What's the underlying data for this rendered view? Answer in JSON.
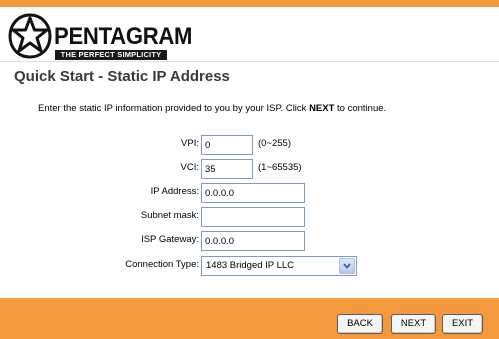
{
  "brand": {
    "name": "PENTAGRAM",
    "tagline": "THE PERFECT SIMPLICITY",
    "accent_color": "#f59a3c"
  },
  "page": {
    "title": "Quick Start - Static IP Address",
    "instructions_prefix": "Enter the static IP information provided to you by your ISP. Click ",
    "instructions_bold": "NEXT",
    "instructions_suffix": " to continue."
  },
  "form": {
    "vpi": {
      "label": "VPI:",
      "value": "0",
      "range": "(0~255)"
    },
    "vci": {
      "label": "VCI:",
      "value": "35",
      "range": "(1~65535)"
    },
    "ip_address": {
      "label": "IP Address:",
      "value": "0.0.0.0"
    },
    "subnet_mask": {
      "label": "Subnet mask:",
      "value": ""
    },
    "isp_gateway": {
      "label": "ISP Gateway:",
      "value": "0.0.0.0"
    },
    "connection_type": {
      "label": "Connection Type:",
      "selected": "1483 Bridged IP LLC"
    }
  },
  "buttons": {
    "back": "BACK",
    "next": "NEXT",
    "exit": "EXIT"
  }
}
